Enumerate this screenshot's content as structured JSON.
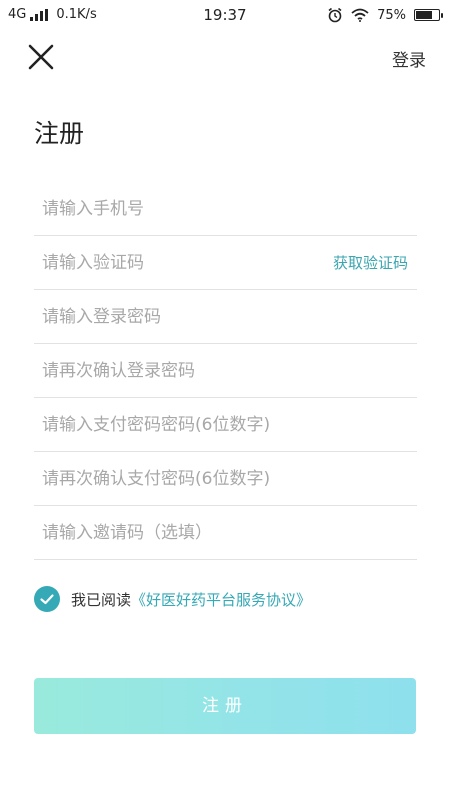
{
  "status_bar": {
    "network": "4G",
    "speed": "0.1K/s",
    "time": "19:37",
    "battery": "75%",
    "battery_level": 0.75,
    "icons": [
      "signal-icon",
      "alarm-icon",
      "wifi-icon",
      "battery-icon"
    ]
  },
  "nav": {
    "close_icon": "close-icon",
    "login_label": "登录"
  },
  "page": {
    "title": "注册"
  },
  "form": {
    "phone_placeholder": "请输入手机号",
    "code_placeholder": "请输入验证码",
    "get_code_label": "获取验证码",
    "password_placeholder": "请输入登录密码",
    "password_confirm_placeholder": "请再次确认登录密码",
    "pay_password_placeholder": "请输入支付密码密码(6位数字)",
    "pay_password_confirm_placeholder": "请再次确认支付密码(6位数字)",
    "invite_placeholder": "请输入邀请码（选填）"
  },
  "agreement": {
    "checked": true,
    "prefix": "我已阅读",
    "link": "《好医好药平台服务协议》"
  },
  "submit": {
    "label": "注册"
  },
  "colors": {
    "accent": "#35a9b6",
    "button_gradient_start": "#99eadc",
    "button_gradient_end": "#8ee0ec",
    "placeholder": "#a8a8a8",
    "divider": "#e2e2e2"
  }
}
